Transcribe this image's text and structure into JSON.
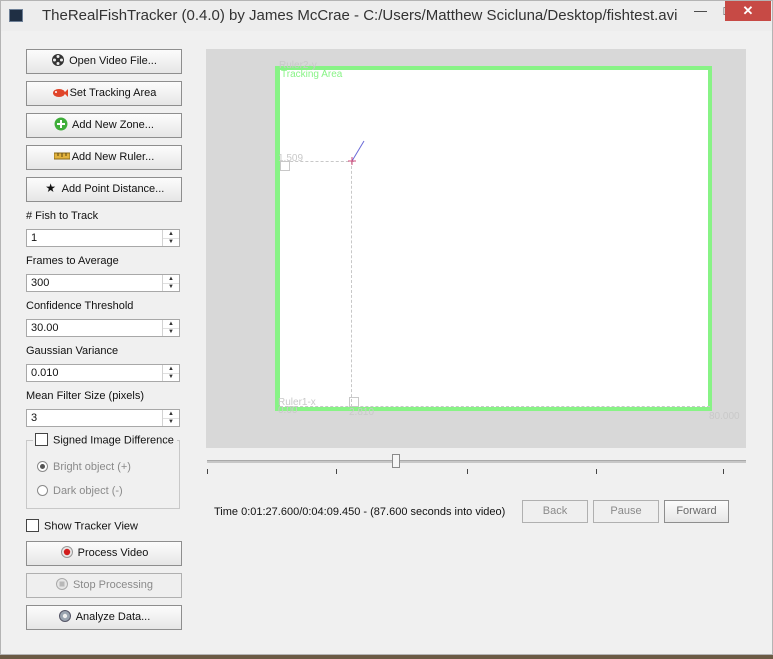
{
  "window": {
    "title": "TheRealFishTracker (0.4.0) by James McCrae - C:/Users/Matthew Scicluna/Desktop/fishtest.avi",
    "min_glyph": "—",
    "max_glyph": "□",
    "close_glyph": "✕"
  },
  "sidebar": {
    "open_video": "Open Video File...",
    "set_tracking_area": "Set Tracking Area",
    "add_new_zone": "Add New Zone...",
    "add_new_ruler": "Add New Ruler...",
    "add_point_distance": "Add Point Distance...",
    "fish_to_track": {
      "label": "# Fish to Track",
      "value": "1"
    },
    "frames_to_average": {
      "label": "Frames to Average",
      "value": "300"
    },
    "confidence_threshold": {
      "label": "Confidence Threshold",
      "value": "30.00"
    },
    "gaussian_variance": {
      "label": "Gaussian Variance",
      "value": "0.010"
    },
    "mean_filter_size": {
      "label": "Mean Filter Size (pixels)",
      "value": "3"
    },
    "signed_image_difference": {
      "label": "Signed Image Difference",
      "checked": false
    },
    "bright_object": {
      "label": "Bright object (+)",
      "selected": true
    },
    "dark_object": {
      "label": "Dark object (-)",
      "selected": false
    },
    "show_tracker_view": {
      "label": "Show Tracker View",
      "checked": false
    },
    "process_video": "Process Video",
    "stop_processing": "Stop Processing",
    "analyze_data": "Analyze Data..."
  },
  "viewer": {
    "tracking_area_label": "Tracking Area",
    "ruler2_label": "Ruler2-y",
    "ruler1_label": "Ruler1-x",
    "y_value": "1.509",
    "origin_value": "0.00",
    "x_value": "2.810",
    "right_value": "80.000"
  },
  "playback": {
    "position_fraction": 0.35,
    "time_text": "Time 0:01:27.600/0:04:09.450 - (87.600 seconds into video)",
    "back": "Back",
    "pause": "Pause",
    "forward": "Forward"
  },
  "colors": {
    "tracking_green": "#88f386",
    "close_red": "#c74a45",
    "record_red": "#d21e1e"
  }
}
